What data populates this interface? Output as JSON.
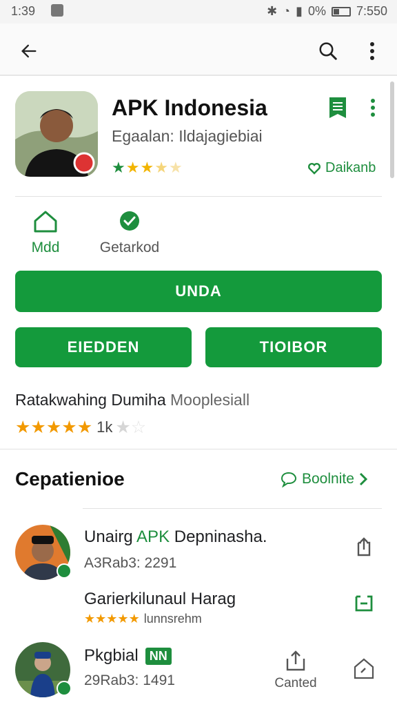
{
  "status_bar": {
    "time": "1:39",
    "battery": "0%",
    "clock_right": "7:550"
  },
  "app": {
    "title": "APK Indonesia",
    "subtitle": "Egaalan: Ildajagiebiai",
    "rating_stars": 3,
    "action_label": "Daikanb"
  },
  "features": [
    {
      "label": "Mdd",
      "icon": "home-icon"
    },
    {
      "label": "Getarkod",
      "icon": "verified-shield-icon"
    }
  ],
  "buttons": {
    "primary": "UNDA",
    "left": "EIEDDEN",
    "right": "TIOIBOR"
  },
  "rating_section": {
    "label": "Ratakwahing Dumiha",
    "label_light": "Mooplesiall",
    "stars": 5,
    "count": "1k"
  },
  "comments": {
    "title": "Cepatienioe",
    "link": "Boolnite",
    "items": [
      {
        "title_prefix": "Unairg ",
        "title_highlight": "APK",
        "title_suffix": " Depninasha.",
        "meta": "A3Rab3: 2291"
      },
      {
        "title": "Garierkilunaul Harag",
        "stars": 5,
        "meta": "lunnsrehm"
      },
      {
        "title": "Pkgbial",
        "tag": "NN",
        "meta": "29Rab3: 1491",
        "action": "Canted"
      }
    ]
  },
  "colors": {
    "accent": "#149a3c",
    "star": "#f29900"
  }
}
